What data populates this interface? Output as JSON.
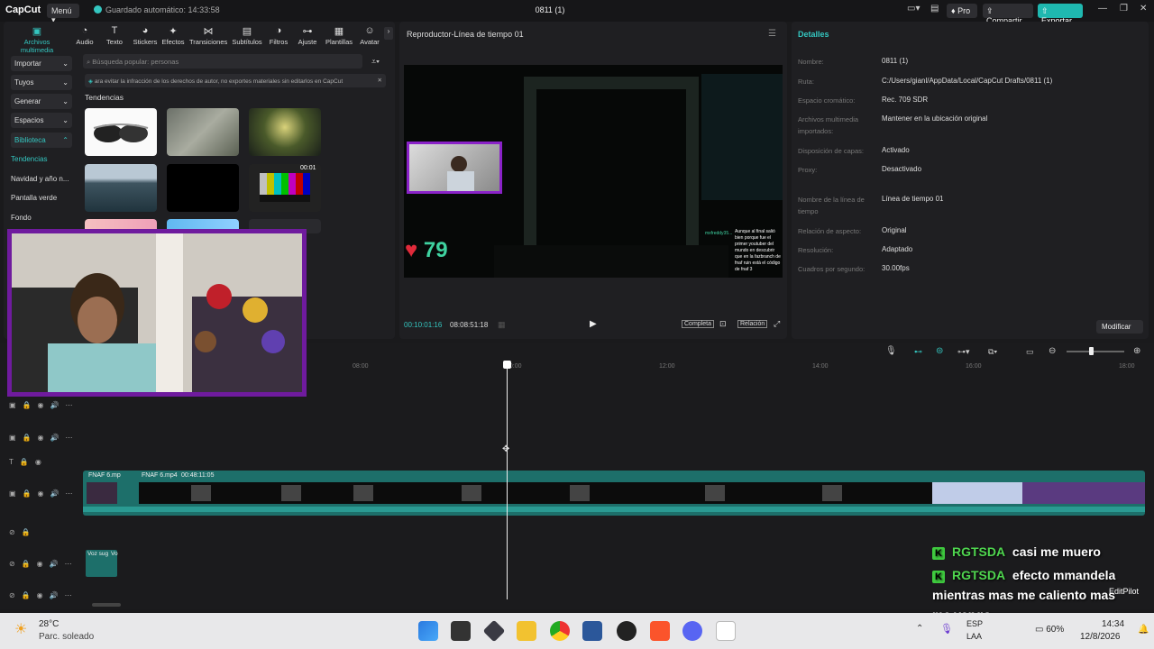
{
  "app": {
    "logo": "CapCut",
    "menu_label": "Menú",
    "autosave": "Guardado automático: 14:33:58",
    "project_title": "0811 (1)",
    "pro_label": "Pro",
    "share_label": "Compartir",
    "export_label": "Exportar"
  },
  "toolbar": [
    {
      "label": "Archivos multimedia",
      "icon": "media-icon",
      "active": true
    },
    {
      "label": "Audio",
      "icon": "audio-icon"
    },
    {
      "label": "Texto",
      "icon": "text-icon"
    },
    {
      "label": "Stickers",
      "icon": "sticker-icon"
    },
    {
      "label": "Efectos",
      "icon": "effects-icon"
    },
    {
      "label": "Transiciones",
      "icon": "transition-icon"
    },
    {
      "label": "Subtítulos",
      "icon": "subtitle-icon"
    },
    {
      "label": "Filtros",
      "icon": "filter-icon"
    },
    {
      "label": "Ajuste",
      "icon": "adjust-icon"
    },
    {
      "label": "Plantillas",
      "icon": "template-icon"
    },
    {
      "label": "Avatar",
      "icon": "avatar-icon"
    }
  ],
  "sidebar": {
    "dropdowns": [
      "Importar",
      "Tuyos",
      "Generar",
      "Espacios",
      "Biblioteca"
    ],
    "items": [
      "Tendencias",
      "Navidad y año n...",
      "Pantalla verde",
      "Fondo"
    ]
  },
  "library": {
    "search_placeholder": "Búsqueda popular: personas",
    "notice": "ara evitar la infracción de los derechos de autor, no exportes materiales sin editarlos en CapCut",
    "section_title": "Tendencias",
    "thumb_duration": "00:01"
  },
  "player": {
    "title": "Reproductor-Línea de tiempo 01",
    "current_time": "00:10:01:16",
    "total_time": "08:08:51:18",
    "full_label": "Completa",
    "ratio_label": "Relación",
    "overlay_counter": "79",
    "overlay_user": "mxfreddy35...",
    "overlay_text": "Aunque al final salió bien porque fue el primer youtuber del mundo en descubrir que en la fazbranch de fnaf ruin está el código de fnaf 3"
  },
  "details": {
    "title": "Detalles",
    "rows": [
      {
        "label": "Nombre:",
        "value": "0811 (1)"
      },
      {
        "label": "Ruta:",
        "value": "C:/Users/gianl/AppData/Local/CapCut Drafts/0811 (1)"
      },
      {
        "label": "Espacio cromático:",
        "value": "Rec. 709 SDR"
      },
      {
        "label": "Archivos multimedia importados:",
        "value": "Mantener en la ubicación original"
      },
      {
        "label": "Disposición de capas:",
        "value": "Activado"
      },
      {
        "label": "Proxy:",
        "value": "Desactivado"
      },
      {
        "label": "Nombre de la línea de tiempo",
        "value": "Línea de tiempo 01"
      },
      {
        "label": "Relación de aspecto:",
        "value": "Original"
      },
      {
        "label": "Resolución:",
        "value": "Adaptado"
      },
      {
        "label": "Cuadros por segundo:",
        "value": "30.00fps"
      }
    ],
    "modify_label": "Modificar"
  },
  "timeline": {
    "ruler": [
      "08:00",
      "10:00",
      "12:00",
      "14:00",
      "16:00",
      "18:00"
    ],
    "clip_a": "FNAF 6.mp",
    "clip_b": "FNAF 6.mp4",
    "clip_b_duration": "00:48:11:05",
    "audio_a": "Voz sug",
    "audio_b": "Vo"
  },
  "chat": [
    {
      "user": "RGTSDA",
      "message": "casi me muero"
    },
    {
      "user": "RGTSDA",
      "message": "efecto mmandela mientras mas me caliento mas me vengo"
    }
  ],
  "editpilot": "EditPilot",
  "taskbar": {
    "weather_temp": "28°C",
    "weather_desc": "Parc. soleado",
    "lang1": "ESP",
    "lang2": "LAA",
    "battery": "60%",
    "time": "14:34",
    "date": "12/8/2026"
  }
}
